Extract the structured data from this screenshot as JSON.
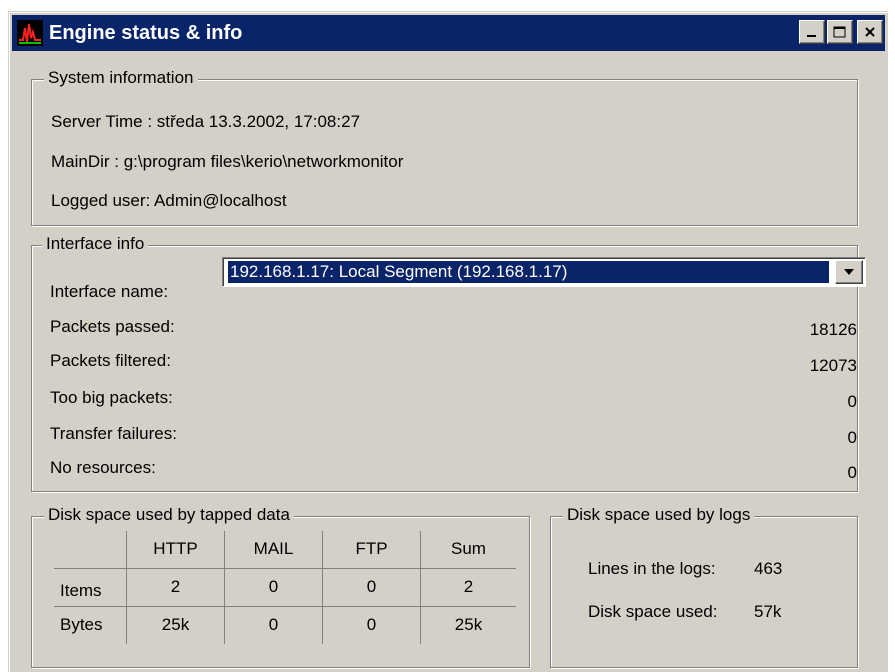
{
  "window": {
    "title": "Engine status & info",
    "controls": {
      "minimize": "minimize",
      "maximize": "maximize",
      "close": "close"
    }
  },
  "system_info": {
    "legend": "System information",
    "server_time": "Server Time :  středa 13.3.2002, 17:08:27",
    "main_dir": "MainDir :  g:\\program files\\kerio\\networkmonitor",
    "logged_user": "Logged user: Admin@localhost"
  },
  "interface_info": {
    "legend": "Interface info",
    "interface_name_label": "Interface name:",
    "interface_selected": "192.168.1.17: Local Segment (192.168.1.17)",
    "rows": [
      {
        "label": "Packets passed:",
        "value": "18126"
      },
      {
        "label": "Packets filtered:",
        "value": "12073"
      },
      {
        "label": "Too big packets:",
        "value": "0"
      },
      {
        "label": "Transfer failures:",
        "value": "0"
      },
      {
        "label": "No resources:",
        "value": "0"
      }
    ]
  },
  "tapped_data": {
    "legend": "Disk space used by tapped data",
    "columns": [
      "",
      "HTTP",
      "MAIL",
      "FTP",
      "Sum"
    ],
    "rows": [
      {
        "label": "Items",
        "values": [
          "2",
          "0",
          "0",
          "2"
        ]
      },
      {
        "label": "Bytes",
        "values": [
          "25k",
          "0",
          "0",
          "25k"
        ]
      }
    ]
  },
  "logs": {
    "legend": "Disk space used by logs",
    "lines_label": "Lines in the logs:",
    "lines_value": "463",
    "disk_label": "Disk space used:",
    "disk_value": "57k"
  },
  "colors": {
    "titlebar": "#0a246a",
    "face": "#d4d0c8",
    "selection": "#0a246a"
  }
}
